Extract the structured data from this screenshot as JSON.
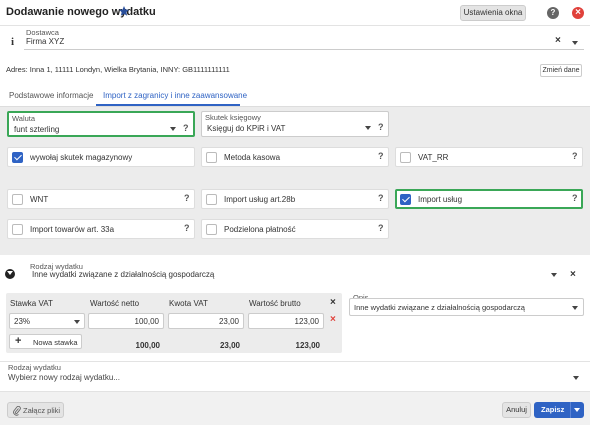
{
  "header": {
    "title": "Dodawanie nowego wydatku",
    "settings_label": "Ustawienia okna",
    "help": "?"
  },
  "supplier": {
    "label": "Dostawca",
    "value": "Firma XYZ",
    "info_icon": "i",
    "clear": "×"
  },
  "address": {
    "text": "Adres: Inna 1, 11111 Londyn, Wielka Brytania, INNY: GB1111111111",
    "change_label": "Zmień dane"
  },
  "tabs": [
    {
      "label": "Podstawowe informacje"
    },
    {
      "label": "Import z zagranicy i inne zaawansowane"
    }
  ],
  "currency": {
    "label": "Waluta",
    "value": "funt szterling"
  },
  "ledger": {
    "label": "Skutek księgowy",
    "value": "Księguj do KPiR i VAT"
  },
  "options": [
    {
      "label": "wywołaj skutek magazynowy",
      "checked": true,
      "help": ""
    },
    {
      "label": "Metoda kasowa",
      "checked": false,
      "help": "?"
    },
    {
      "label": "VAT_RR",
      "checked": false,
      "help": "?"
    },
    {
      "label": "WNT",
      "checked": false,
      "help": "?"
    },
    {
      "label": "Import usług art.28b",
      "checked": false,
      "help": "?"
    },
    {
      "label": "Import usług",
      "checked": true,
      "help": "?"
    },
    {
      "label": "Import towarów art. 33a",
      "checked": false,
      "help": "?"
    },
    {
      "label": "Podzielona płatność",
      "checked": false,
      "help": "?"
    }
  ],
  "expense_type": {
    "label": "Rodzaj wydatku",
    "value": "Inne wydatki związane z działalnością gospodarczą"
  },
  "vat_table": {
    "headers": [
      "Stawka VAT",
      "Wartość netto",
      "Kwota VAT",
      "Wartość brutto"
    ],
    "row": {
      "rate": "23%",
      "net": "100,00",
      "vat": "23,00",
      "gross": "123,00"
    },
    "add_label": "Nowa stawka",
    "totals": {
      "net": "100,00",
      "vat": "23,00",
      "gross": "123,00"
    }
  },
  "description": {
    "label": "Opis",
    "value": "Inne wydatki związane z działalnością gospodarczą"
  },
  "new_expense": {
    "label": "Rodzaj wydatku",
    "placeholder": "Wybierz nowy rodzaj wydatku..."
  },
  "footer": {
    "attach": "Załącz pliki",
    "cancel": "Anuluj",
    "save": "Zapisz"
  },
  "colors": {
    "accent": "#2f63c4",
    "highlight": "#3aa757",
    "close": "#e0413b"
  }
}
